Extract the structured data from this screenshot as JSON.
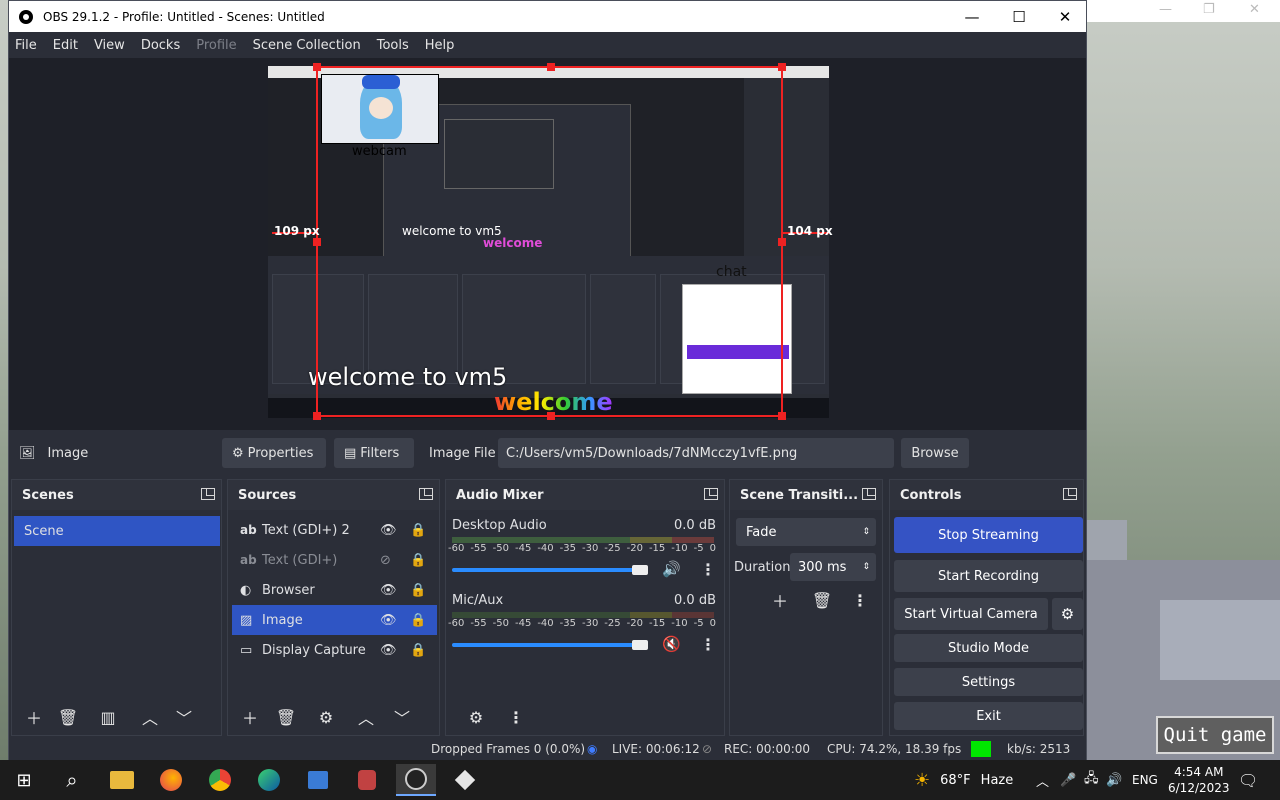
{
  "window": {
    "title": "OBS 29.1.2 - Profile: Untitled - Scenes: Untitled"
  },
  "menu": [
    "File",
    "Edit",
    "View",
    "Docks",
    "Profile",
    "Scene Collection",
    "Tools",
    "Help"
  ],
  "preview": {
    "crop_left": "109 px",
    "crop_right": "104 px",
    "webcam_label": "webcam",
    "chat_label": "chat",
    "overlay_text": "welcome to vm5",
    "welcome_text": "welcome"
  },
  "context_bar": {
    "source_name": "Image",
    "properties_label": "Properties",
    "filters_label": "Filters",
    "image_file_label": "Image File",
    "image_file_path": "C:/Users/vm5/Downloads/7dNMcczy1vfE.png",
    "browse_label": "Browse"
  },
  "scenes": {
    "title": "Scenes",
    "items": [
      "Scene"
    ]
  },
  "sources": {
    "title": "Sources",
    "items": [
      {
        "label": "Text (GDI+) 2",
        "icon": "text-icon",
        "visible": true
      },
      {
        "label": "Text (GDI+)",
        "icon": "text-icon",
        "visible": false
      },
      {
        "label": "Browser",
        "icon": "globe-icon",
        "visible": true
      },
      {
        "label": "Image",
        "icon": "image-icon",
        "visible": true,
        "selected": true
      },
      {
        "label": "Display Capture",
        "icon": "monitor-icon",
        "visible": true
      }
    ]
  },
  "audio_mixer": {
    "title": "Audio Mixer",
    "channels": [
      {
        "name": "Desktop Audio",
        "db": "0.0 dB",
        "muted": false,
        "volume": 0.98
      },
      {
        "name": "Mic/Aux",
        "db": "0.0 dB",
        "muted": true,
        "volume": 0.98
      }
    ],
    "scale": [
      "-60",
      "-55",
      "-50",
      "-45",
      "-40",
      "-35",
      "-30",
      "-25",
      "-20",
      "-15",
      "-10",
      "-5",
      "0"
    ]
  },
  "transitions": {
    "title": "Scene Transiti...",
    "type": "Fade",
    "duration_label": "Duration",
    "duration_value": "300 ms"
  },
  "controls": {
    "title": "Controls",
    "stop_streaming": "Stop Streaming",
    "start_recording": "Start Recording",
    "start_virtual_camera": "Start Virtual Camera",
    "studio_mode": "Studio Mode",
    "settings": "Settings",
    "exit": "Exit"
  },
  "status": {
    "dropped_frames": "Dropped Frames 0 (0.0%)",
    "live": "LIVE: 00:06:12",
    "rec": "REC: 00:00:00",
    "cpu": "CPU: 74.2%, 18.39 fps",
    "kbs": "kb/s: 2513"
  },
  "game": {
    "quit_label": "Quit game"
  },
  "taskbar": {
    "weather_temp": "68°F",
    "weather_desc": "Haze",
    "lang": "ENG",
    "time": "4:54 AM",
    "date": "6/12/2023"
  },
  "colors": {
    "accent": "#3553c4",
    "selection_red": "#e22222",
    "stream_ok": "#00e600"
  }
}
